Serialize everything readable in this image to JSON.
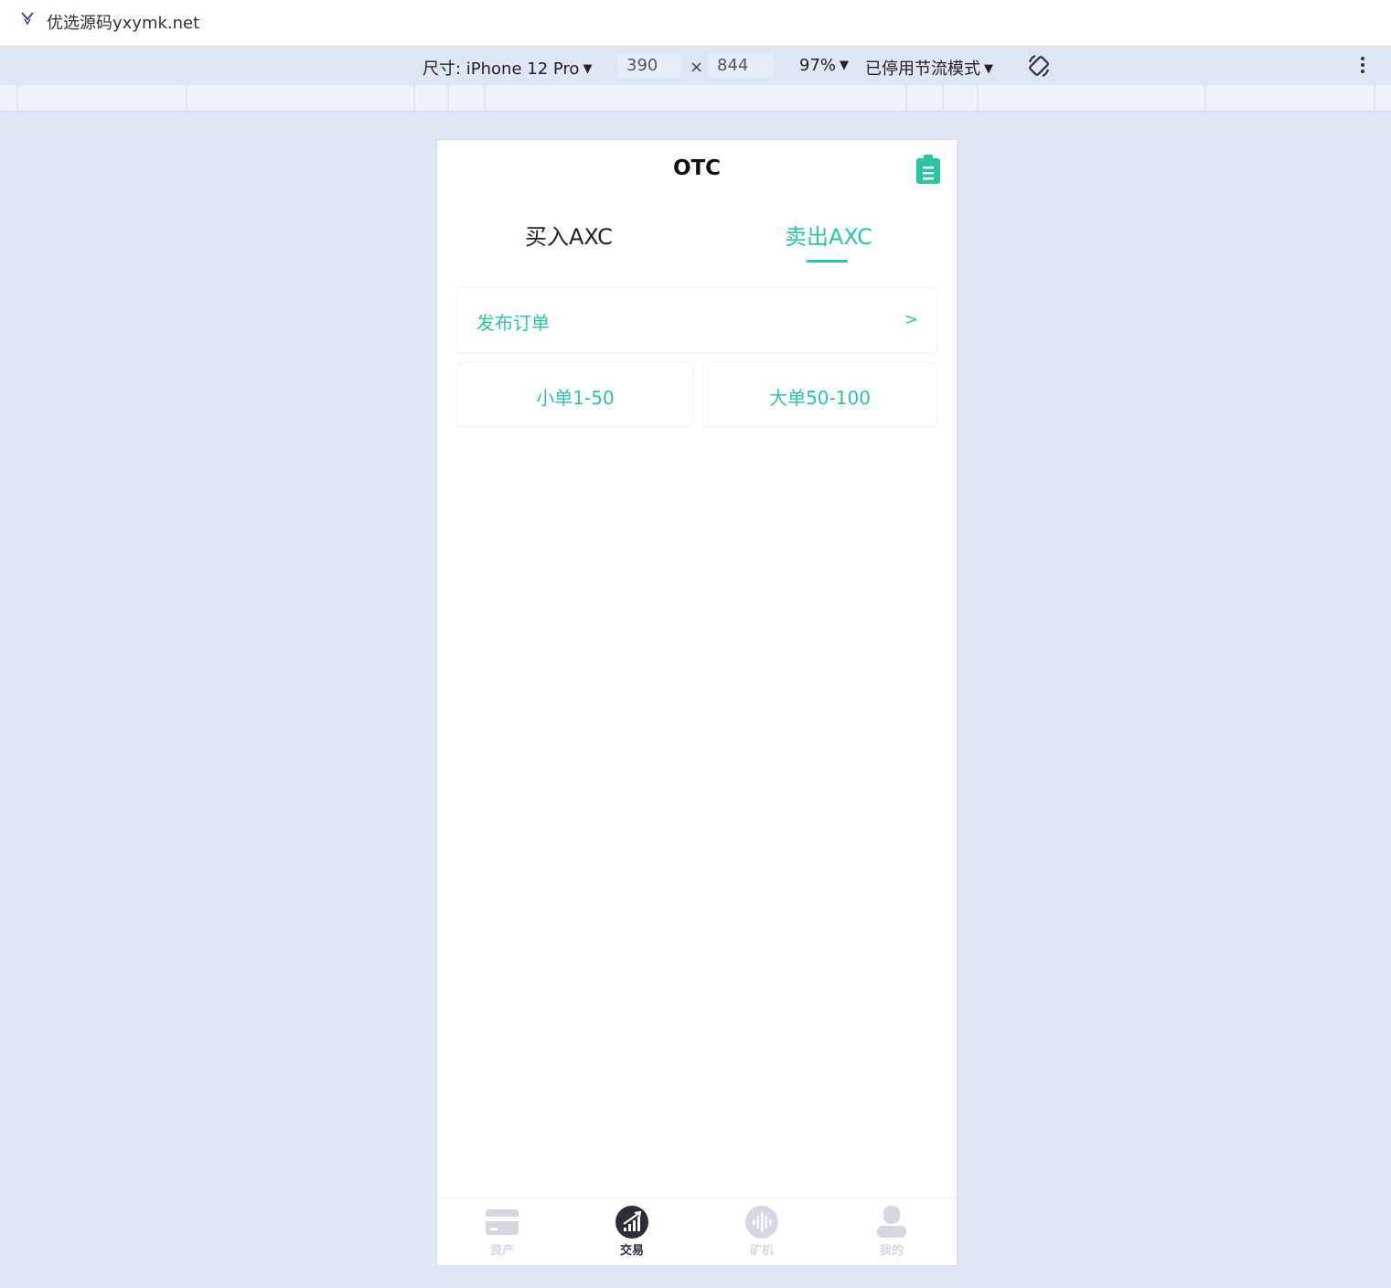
{
  "browser": {
    "tab_title": "优选源码yxymk.net"
  },
  "devtools": {
    "device_label": "尺寸: iPhone 12 Pro",
    "width": "390",
    "times": "×",
    "height": "844",
    "zoom": "97%",
    "throttling": "已停用节流模式",
    "dropdown_caret": "▼"
  },
  "app": {
    "title": "OTC",
    "tabs": [
      {
        "label": "买入AXC",
        "active": false
      },
      {
        "label": "卖出AXC",
        "active": true
      }
    ],
    "publish_order": {
      "label": "发布订单",
      "arrow": ">"
    },
    "order_sizes": [
      {
        "label": "小单1-50"
      },
      {
        "label": "大单50-100"
      }
    ],
    "bottom_nav": [
      {
        "label": "资产",
        "icon": "card-icon",
        "active": false
      },
      {
        "label": "交易",
        "icon": "trade-chart-icon",
        "active": true
      },
      {
        "label": "矿机",
        "icon": "sound-wave-icon",
        "active": false
      },
      {
        "label": "我的",
        "icon": "user-icon",
        "active": false
      }
    ]
  },
  "colors": {
    "accent": "#2ec4a2",
    "nav_inactive": "#d4d8e2",
    "nav_active": "#2b2d3a",
    "background": "#dfe6f3"
  }
}
